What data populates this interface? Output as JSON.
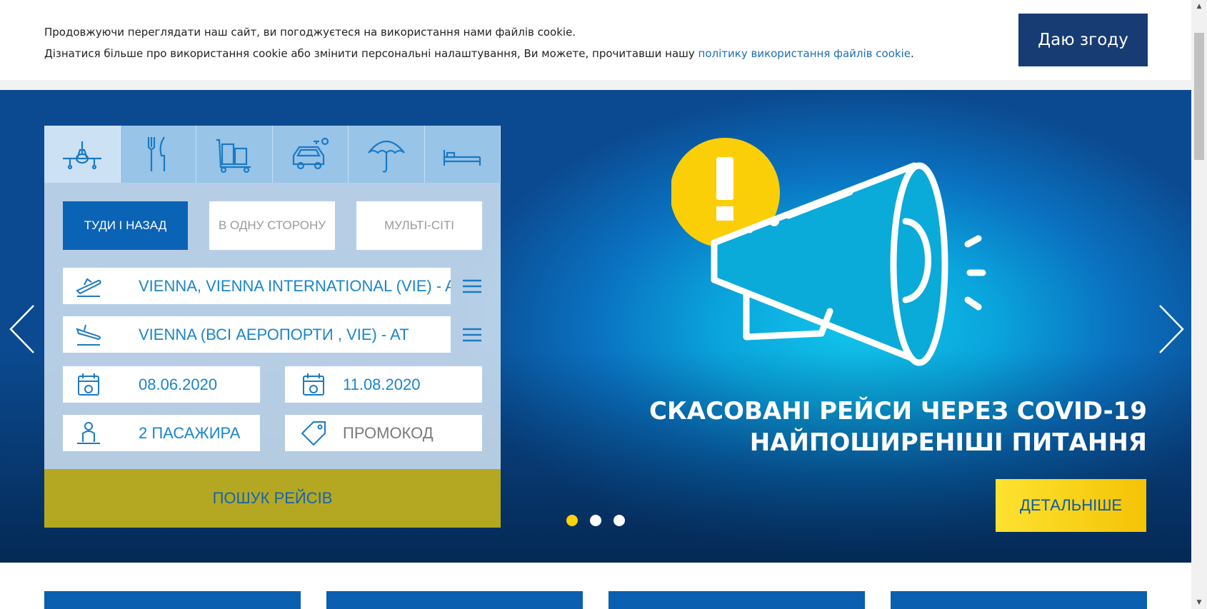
{
  "cookie": {
    "line1": "Продовжуючи переглядати наш сайт, ви погоджуєтеся на використання нами файлів cookie.",
    "line2_prefix": "Дізнатися більше про використання cookie або змінити персональні налаштування, Ви можете, прочитавши нашу ",
    "policy_link": "політику використання файлів cookie",
    "line2_suffix": ".",
    "agree_label": "Даю згоду"
  },
  "booking": {
    "service_tabs": [
      {
        "icon": "airplane-icon"
      },
      {
        "icon": "cutlery-icon"
      },
      {
        "icon": "luggage-cart-icon"
      },
      {
        "icon": "car-rental-icon"
      },
      {
        "icon": "umbrella-icon"
      },
      {
        "icon": "bed-icon"
      }
    ],
    "trip_types": [
      "ТУДИ І НАЗАД",
      "В ОДНУ СТОРОНУ",
      "МУЛЬТІ-СІТІ"
    ],
    "from": "VIENNA, VIENNA INTERNATIONAL  (VIE) - AT",
    "to": "VIENNA (ВСІ АЕРОПОРТИ , VIE) - AT",
    "departure_date": "08.06.2020",
    "return_date": "11.08.2020",
    "passengers": "2 ПАСАЖИРА",
    "promo_placeholder": "ПРОМОКОД",
    "search_label": "ПОШУК РЕЙСІВ"
  },
  "slide": {
    "headline_line1": "СКАСОВАНІ РЕЙСИ ЧЕРЕЗ COVID-19",
    "headline_line2": "НАЙПОШИРЕНІШІ ПИТАННЯ",
    "more_label": "ДЕТАЛЬНІШЕ",
    "dots": 3,
    "active_dot": 0
  },
  "colors": {
    "accent_blue": "#0b63b5",
    "cookie_button": "#173c74",
    "search_button": "#b4a823",
    "slide_button": "#fcd20a"
  }
}
